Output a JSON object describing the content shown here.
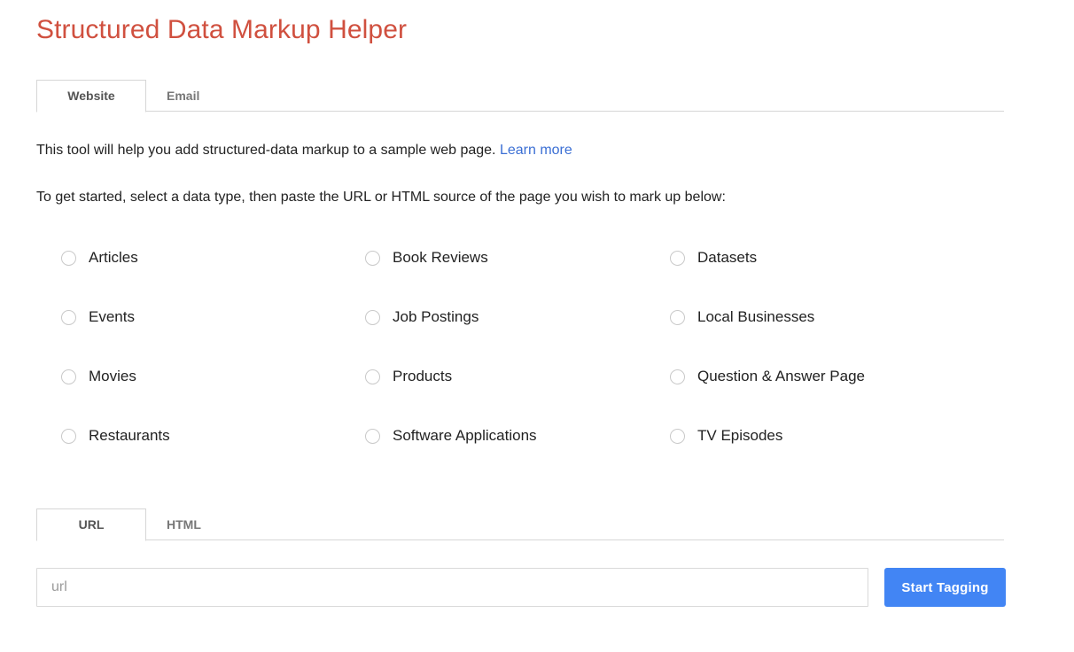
{
  "page": {
    "title": "Structured Data Markup Helper"
  },
  "main_tabs": [
    {
      "label": "Website",
      "active": true
    },
    {
      "label": "Email",
      "active": false
    }
  ],
  "intro": {
    "line1_before_link": "This tool will help you add structured-data markup to a sample web page. ",
    "line1_link": "Learn more",
    "line2": "To get started, select a data type, then paste the URL or HTML source of the page you wish to mark up below:"
  },
  "data_types": {
    "selected": null,
    "rows": [
      [
        "Articles",
        "Book Reviews",
        "Datasets"
      ],
      [
        "Events",
        "Job Postings",
        "Local Businesses"
      ],
      [
        "Movies",
        "Products",
        "Question & Answer Page"
      ],
      [
        "Restaurants",
        "Software Applications",
        "TV Episodes"
      ]
    ]
  },
  "source_tabs": [
    {
      "label": "URL",
      "active": true
    },
    {
      "label": "HTML",
      "active": false
    }
  ],
  "url_field": {
    "value": "",
    "placeholder": "url"
  },
  "start_button": {
    "label": "Start Tagging"
  },
  "colors": {
    "title": "#d0503f",
    "link": "#3b6fd4",
    "button": "#4285f4",
    "border": "#d6d6d6",
    "radio_border": "#c9c9c9",
    "placeholder": "#9b9b9b"
  }
}
